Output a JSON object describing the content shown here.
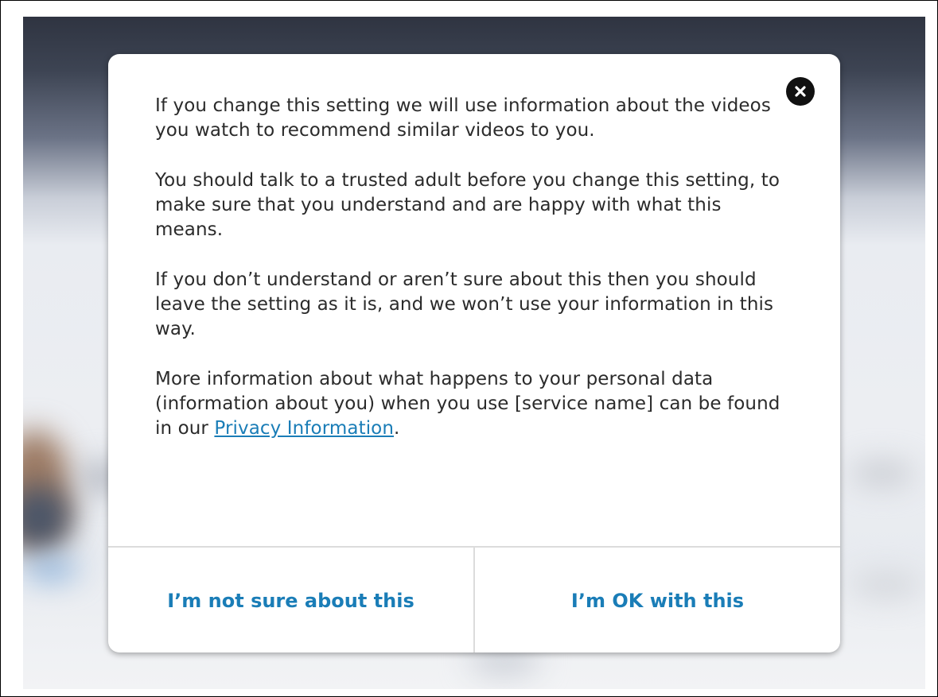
{
  "dialog": {
    "paragraphs": [
      "If you change this setting we will use information about the videos you watch to recommend similar videos to you.",
      "You should talk to a trusted adult before you change this setting, to make sure that you understand and are happy with what this means.",
      "If you don’t understand or aren’t sure about this then you should leave the setting as it is, and we won’t use your information in this way."
    ],
    "privacy_text_before": "More information about what happens to your personal data (information about you) when you use [service name] can be found in our ",
    "privacy_link": "Privacy Information",
    "privacy_text_after": ".",
    "close_icon": "close-icon",
    "actions": {
      "decline_label": "I’m not sure about this",
      "accept_label": "I’m OK with this"
    }
  },
  "colors": {
    "link": "#1a7db7",
    "text": "#2b2b2b",
    "divider": "#dcdcdc",
    "close_button": "#111111"
  }
}
